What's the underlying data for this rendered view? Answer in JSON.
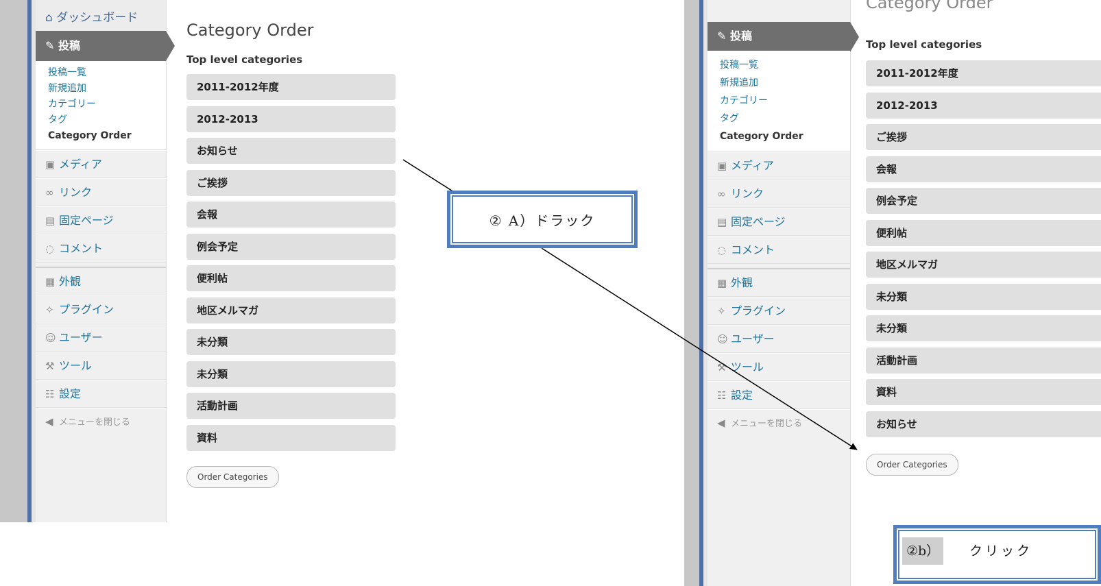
{
  "left_screen": {
    "menu": {
      "dashboard": "ダッシュボード",
      "posts": "投稿",
      "submenu": [
        "投稿一覧",
        "新規追加",
        "カテゴリー",
        "タグ",
        "Category Order"
      ],
      "media": "メディア",
      "links": "リンク",
      "pages": "固定ページ",
      "comments": "コメント",
      "appearance": "外観",
      "plugins": "プラグイン",
      "users": "ユーザー",
      "tools": "ツール",
      "settings": "設定",
      "collapse": "メニューを閉じる"
    },
    "page_title": "Category Order",
    "subtitle": "Top level categories",
    "categories": [
      "2011-2012年度",
      "2012-2013",
      "お知らせ",
      "ご挨拶",
      "会報",
      "例会予定",
      "便利帖",
      "地区メルマガ",
      "未分類",
      "未分類",
      "活動計画",
      "資料"
    ],
    "order_button": "Order Categories"
  },
  "right_screen": {
    "menu": {
      "posts": "投稿",
      "submenu": [
        "投稿一覧",
        "新規追加",
        "カテゴリー",
        "タグ",
        "Category Order"
      ],
      "media": "メディア",
      "links": "リンク",
      "pages": "固定ページ",
      "comments": "コメント",
      "appearance": "外観",
      "plugins": "プラグイン",
      "users": "ユーザー",
      "tools": "ツール",
      "settings": "設定",
      "collapse": "メニューを閉じる"
    },
    "page_title": "Category Order",
    "subtitle": "Top level categories",
    "categories": [
      "2011-2012年度",
      "2012-2013",
      "ご挨拶",
      "会報",
      "例会予定",
      "便利帖",
      "地区メルマガ",
      "未分類",
      "未分類",
      "活動計画",
      "資料",
      "お知らせ"
    ],
    "order_button": "Order Categories"
  },
  "annotations": {
    "drag_label": "② A）ドラック",
    "click_circle": "②b）",
    "click_text": "クリック"
  },
  "colors": {
    "callout_border": "#4f7dbd",
    "menu_active": "#6f6f6f",
    "category_bg": "#e0e0e0",
    "link": "#21759b"
  }
}
